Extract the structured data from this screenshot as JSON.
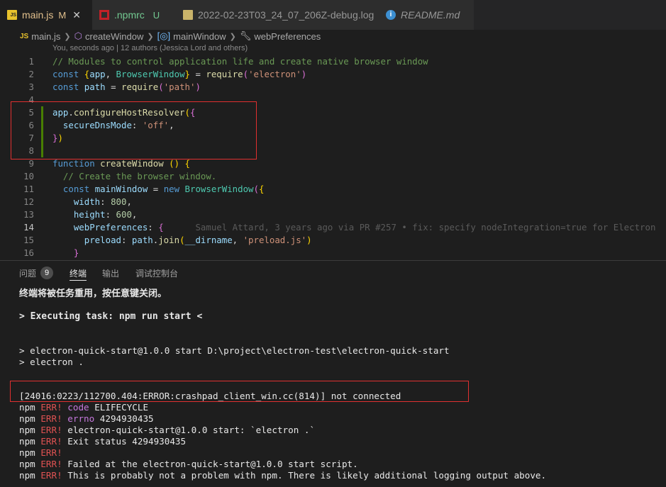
{
  "tabs": [
    {
      "label": "main.js",
      "status": "M",
      "icon": "js-file-icon",
      "active": true
    },
    {
      "label": ".npmrc",
      "status": "U",
      "icon": "npm-file-icon",
      "active": false
    },
    {
      "label": "2022-02-23T03_24_07_206Z-debug.log",
      "status": "",
      "icon": "log-file-icon",
      "active": false
    },
    {
      "label": "README.md",
      "status": "",
      "icon": "info-file-icon",
      "active": false
    }
  ],
  "breadcrumb": [
    "main.js",
    "createWindow",
    "mainWindow",
    "webPreferences"
  ],
  "blame_top": "You, seconds ago | 12 authors (Jessica Lord and others)",
  "code_lines": [
    {
      "n": "1",
      "tokens": [
        [
          "c-com",
          "// Modules to control application life and create native browser window"
        ]
      ]
    },
    {
      "n": "2",
      "tokens": [
        [
          "c-kw",
          "const "
        ],
        [
          "c-br",
          "{"
        ],
        [
          "c-var",
          "app"
        ],
        [
          "c-p",
          ", "
        ],
        [
          "c-cls",
          "BrowserWindow"
        ],
        [
          "c-br",
          "}"
        ],
        [
          "c-p",
          " = "
        ],
        [
          "c-fn",
          "require"
        ],
        [
          "c-br2",
          "("
        ],
        [
          "c-str",
          "'electron'"
        ],
        [
          "c-br2",
          ")"
        ]
      ]
    },
    {
      "n": "3",
      "tokens": [
        [
          "c-kw",
          "const "
        ],
        [
          "c-var",
          "path"
        ],
        [
          "c-p",
          " = "
        ],
        [
          "c-fn",
          "require"
        ],
        [
          "c-br2",
          "("
        ],
        [
          "c-str",
          "'path'"
        ],
        [
          "c-br2",
          ")"
        ]
      ]
    },
    {
      "n": "4",
      "tokens": []
    },
    {
      "n": "5",
      "tokens": [
        [
          "c-var",
          "app"
        ],
        [
          "c-p",
          "."
        ],
        [
          "c-fn",
          "configureHostResolver"
        ],
        [
          "c-br",
          "("
        ],
        [
          "c-br2",
          "{"
        ]
      ]
    },
    {
      "n": "6",
      "tokens": [
        [
          "c-p",
          "  "
        ],
        [
          "c-var",
          "secureDnsMode"
        ],
        [
          "c-p",
          ": "
        ],
        [
          "c-str",
          "'off'"
        ],
        [
          "c-p",
          ","
        ]
      ]
    },
    {
      "n": "7",
      "tokens": [
        [
          "c-br2",
          "}"
        ],
        [
          "c-br",
          ")"
        ]
      ]
    },
    {
      "n": "8",
      "tokens": []
    },
    {
      "n": "9",
      "tokens": [
        [
          "c-kw",
          "function "
        ],
        [
          "c-fn",
          "createWindow "
        ],
        [
          "c-br",
          "()"
        ],
        [
          "c-p",
          " "
        ],
        [
          "c-br",
          "{"
        ]
      ]
    },
    {
      "n": "10",
      "tokens": [
        [
          "c-p",
          "  "
        ],
        [
          "c-com",
          "// Create the browser window."
        ]
      ]
    },
    {
      "n": "11",
      "tokens": [
        [
          "c-p",
          "  "
        ],
        [
          "c-kw",
          "const "
        ],
        [
          "c-var",
          "mainWindow"
        ],
        [
          "c-p",
          " = "
        ],
        [
          "c-kw",
          "new "
        ],
        [
          "c-cls",
          "BrowserWindow"
        ],
        [
          "c-br2",
          "("
        ],
        [
          "c-br",
          "{"
        ]
      ]
    },
    {
      "n": "12",
      "tokens": [
        [
          "c-p",
          "    "
        ],
        [
          "c-var",
          "width"
        ],
        [
          "c-p",
          ": "
        ],
        [
          "c-num",
          "800"
        ],
        [
          "c-p",
          ","
        ]
      ]
    },
    {
      "n": "13",
      "tokens": [
        [
          "c-p",
          "    "
        ],
        [
          "c-var",
          "height"
        ],
        [
          "c-p",
          ": "
        ],
        [
          "c-num",
          "600"
        ],
        [
          "c-p",
          ","
        ]
      ]
    },
    {
      "n": "14",
      "tokens": [
        [
          "c-p",
          "    "
        ],
        [
          "c-var",
          "webPreferences"
        ],
        [
          "c-p",
          ": "
        ],
        [
          "c-br2",
          "{"
        ],
        [
          "c-p",
          "      "
        ],
        [
          "c-blame",
          "Samuel Attard, 3 years ago via PR #257 • fix: specify nodeIntegration=true for Electron"
        ]
      ]
    },
    {
      "n": "15",
      "tokens": [
        [
          "c-p",
          "      "
        ],
        [
          "c-var",
          "preload"
        ],
        [
          "c-p",
          ": "
        ],
        [
          "c-var",
          "path"
        ],
        [
          "c-p",
          "."
        ],
        [
          "c-fn",
          "join"
        ],
        [
          "c-br",
          "("
        ],
        [
          "c-var",
          "__dirname"
        ],
        [
          "c-p",
          ", "
        ],
        [
          "c-str",
          "'preload.js'"
        ],
        [
          "c-br",
          ")"
        ]
      ]
    },
    {
      "n": "16",
      "tokens": [
        [
          "c-p",
          "    "
        ],
        [
          "c-br2",
          "}"
        ]
      ]
    }
  ],
  "panel_tabs": [
    {
      "label": "问题",
      "badge": "9",
      "active": false
    },
    {
      "label": "终端",
      "badge": "",
      "active": true
    },
    {
      "label": "输出",
      "badge": "",
      "active": false
    },
    {
      "label": "调试控制台",
      "badge": "",
      "active": false
    }
  ],
  "terminal": {
    "reuse_msg": "终端将被任务重用，按任意键关闭。",
    "exec": "> Executing task: npm run start <",
    "cmd1": "> electron-quick-start@1.0.0 start D:\\project\\electron-test\\electron-quick-start",
    "cmd2": "> electron .",
    "crash": "[24016:0223/112700.404:ERROR:crashpad_client_win.cc(814)] not connected",
    "npm_lines": [
      {
        "prefix": "npm",
        "err": "ERR!",
        "key": "code",
        "text": " ELIFECYCLE"
      },
      {
        "prefix": "npm",
        "err": "ERR!",
        "key": "errno",
        "text": " 4294930435"
      },
      {
        "prefix": "npm",
        "err": "ERR!",
        "key": "",
        "text": " electron-quick-start@1.0.0 start: `electron .`"
      },
      {
        "prefix": "npm",
        "err": "ERR!",
        "key": "",
        "text": " Exit status 4294930435"
      },
      {
        "prefix": "npm",
        "err": "ERR!",
        "key": "",
        "text": ""
      },
      {
        "prefix": "npm",
        "err": "ERR!",
        "key": "",
        "text": " Failed at the electron-quick-start@1.0.0 start script."
      },
      {
        "prefix": "npm",
        "err": "ERR!",
        "key": "",
        "text": " This is probably not a problem with npm. There is likely additional logging output above."
      }
    ]
  },
  "colors": {
    "highlight_box": "#e03030",
    "git_added": "#487e02"
  }
}
